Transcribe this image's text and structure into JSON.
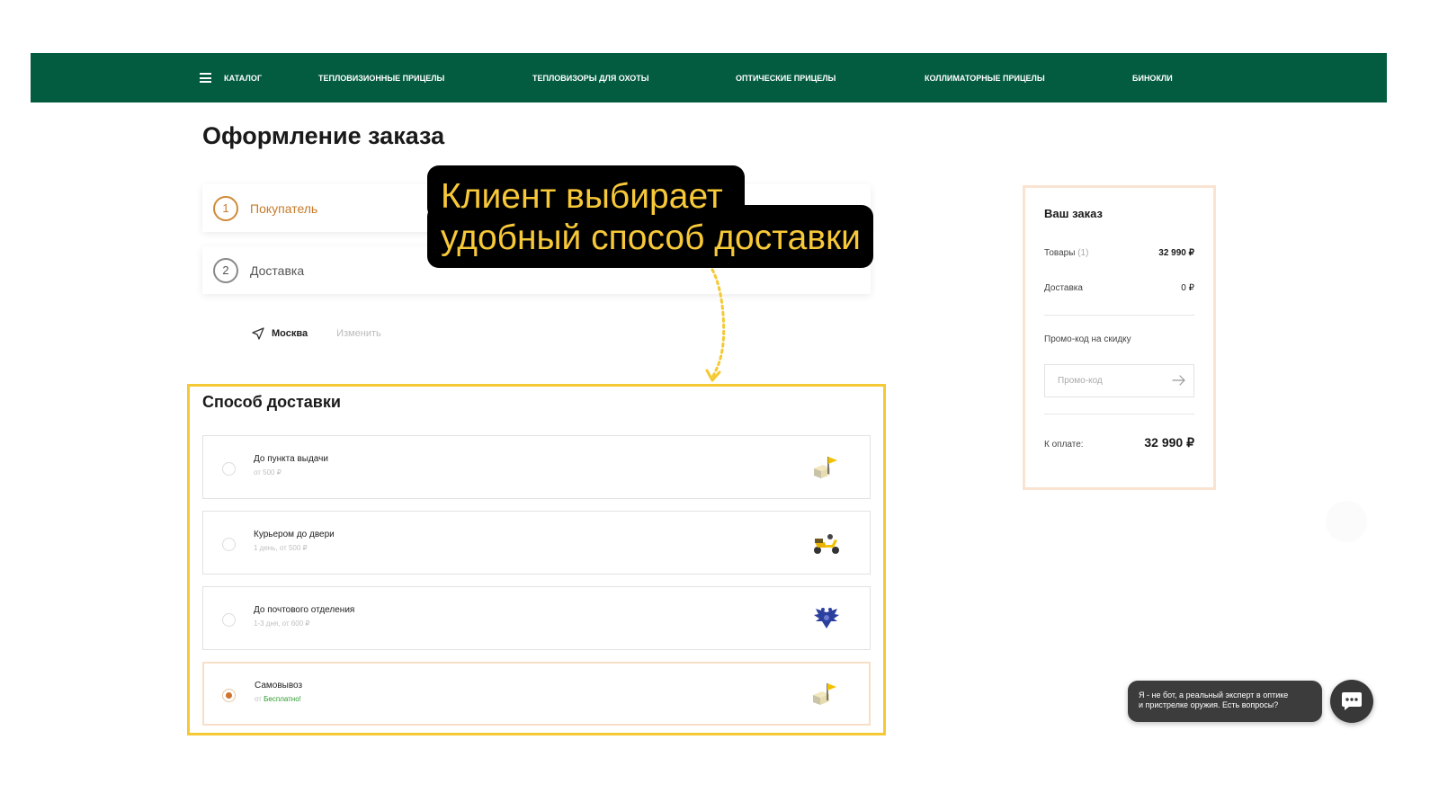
{
  "nav": {
    "catalog_label": "КАТАЛОГ",
    "items": [
      {
        "label": "ТЕПЛОВИЗИОННЫЕ ПРИЦЕЛЫ"
      },
      {
        "label": "ТЕПЛОВИЗОРЫ ДЛЯ ОХОТЫ"
      },
      {
        "label": "ОПТИЧЕСКИЕ ПРИЦЕЛЫ"
      },
      {
        "label": "КОЛЛИМАТОРНЫЕ ПРИЦЕЛЫ"
      },
      {
        "label": "БИНОКЛИ"
      }
    ],
    "background": "#035c3f"
  },
  "page_title": "Оформление заказа",
  "steps": [
    {
      "number": "1",
      "label": "Покупатель",
      "active": true
    },
    {
      "number": "2",
      "label": "Доставка",
      "active": false
    }
  ],
  "city": {
    "name": "Москва",
    "change_label": "Изменить",
    "icon": "location-arrow-icon"
  },
  "annotation": {
    "line1": "Клиент выбирает",
    "line2": "удобный способ доставки",
    "text_color": "#f7c838"
  },
  "delivery": {
    "title": "Способ доставки",
    "options": [
      {
        "title": "До пункта выдачи",
        "subtitle": "от 500 ₽",
        "icon": "pickup-point-flag-icon",
        "selected": false
      },
      {
        "title": "Курьером до двери",
        "subtitle": "1 день, от 500 ₽",
        "icon": "courier-scooter-icon",
        "selected": false
      },
      {
        "title": "До почтового отделения",
        "subtitle": "1-3 дня, от 600 ₽",
        "icon": "russian-post-eagle-icon",
        "selected": false
      },
      {
        "title": "Самовывоз",
        "subtitle_prefix": "от",
        "subtitle_highlight": "Бесплатно!",
        "icon": "pickup-flag-icon",
        "selected": true
      }
    ],
    "highlight_color": "#f5c933"
  },
  "summary": {
    "title": "Ваш заказ",
    "goods_label": "Товары",
    "goods_count": "(1)",
    "goods_value": "32 990 ₽",
    "delivery_label": "Доставка",
    "delivery_value": "0 ₽",
    "promo_label": "Промо-код на скидку",
    "promo_placeholder": "Промо-код",
    "pay_label": "К оплате:",
    "pay_value": "32 990 ₽"
  },
  "chat": {
    "line1": "Я - не бот, а реальный эксперт в оптике",
    "line2": "и пристрелке оружия. Есть вопросы?"
  }
}
